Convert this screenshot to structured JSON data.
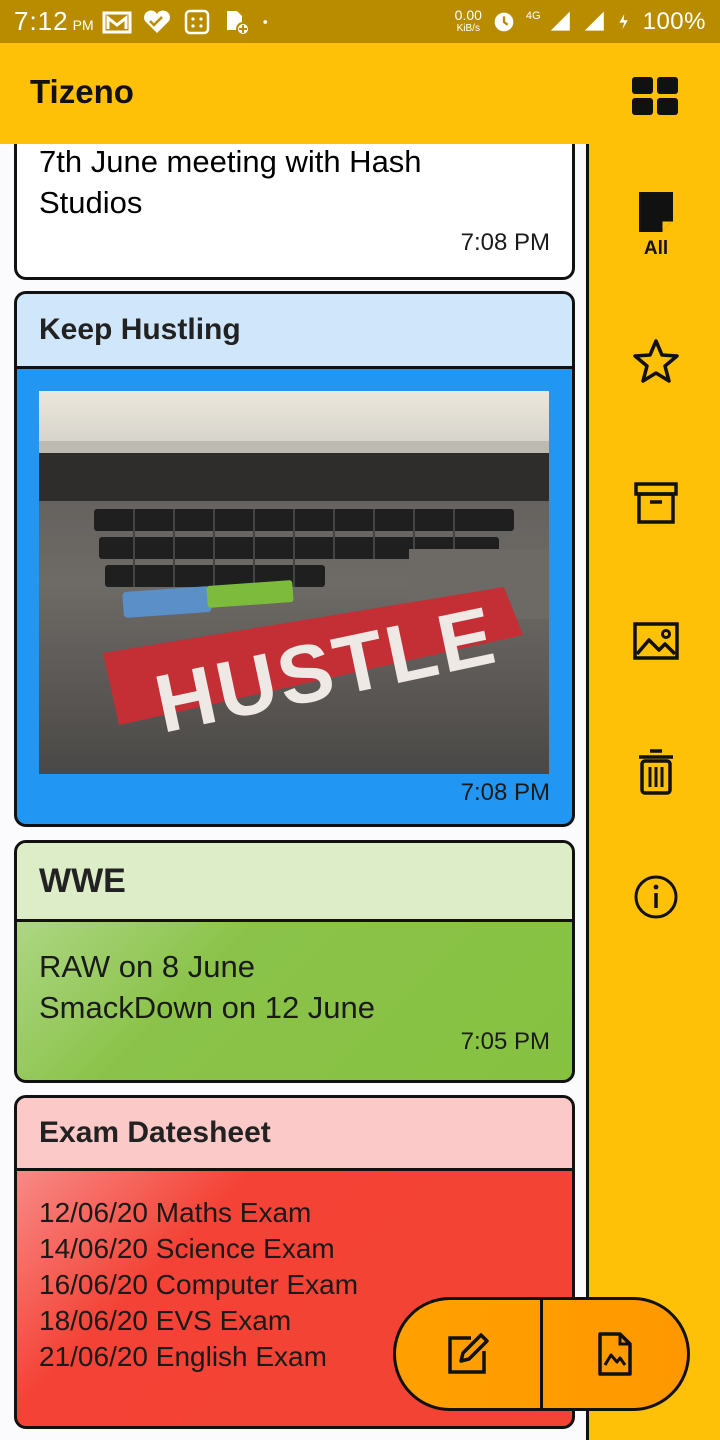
{
  "status_bar": {
    "time": "7:12",
    "ampm": "PM",
    "net_speed_value": "0.00",
    "net_speed_unit": "KiB/s",
    "network": "4G",
    "battery": "100%",
    "icons": [
      "gmail-icon",
      "health-icon",
      "calculator-icon",
      "file-icon",
      "dot-icon",
      "alarm-icon",
      "signal-icon",
      "charging-icon"
    ]
  },
  "app_bar": {
    "title": "Tizeno",
    "grid_icon": "grid-view-icon"
  },
  "side_rail": {
    "items": [
      {
        "icon": "note-icon",
        "label": "All",
        "selected": true
      },
      {
        "icon": "star-icon",
        "label": ""
      },
      {
        "icon": "archive-icon",
        "label": ""
      },
      {
        "icon": "image-icon",
        "label": ""
      },
      {
        "icon": "trash-icon",
        "label": ""
      },
      {
        "icon": "info-icon",
        "label": ""
      }
    ]
  },
  "notes": [
    {
      "title": "",
      "body": "7th June meeting with Hash\nStudios",
      "time": "7:08 PM",
      "color": "#ffffff"
    },
    {
      "title": "Keep Hustling",
      "body": "",
      "has_image": true,
      "time": "7:08 PM",
      "color": "#2196f3",
      "header_color": "#cfe6fb"
    },
    {
      "title": "WWE",
      "body": "RAW on 8 June\nSmackDown on 12 June",
      "time": "7:05 PM",
      "color": "#8bc34a",
      "header_color": "#dcedc8"
    },
    {
      "title": "Exam Datesheet",
      "body": "12/06/20 Maths Exam\n14/06/20 Science Exam\n16/06/20 Computer Exam\n18/06/20 EVS Exam\n21/06/20 English Exam",
      "color": "#f44336",
      "header_color": "#fbc9c7"
    }
  ],
  "image_text": "HUSTLE",
  "fab": {
    "left_icon": "edit-note-icon",
    "right_icon": "image-note-icon",
    "color": "#ff9800"
  }
}
